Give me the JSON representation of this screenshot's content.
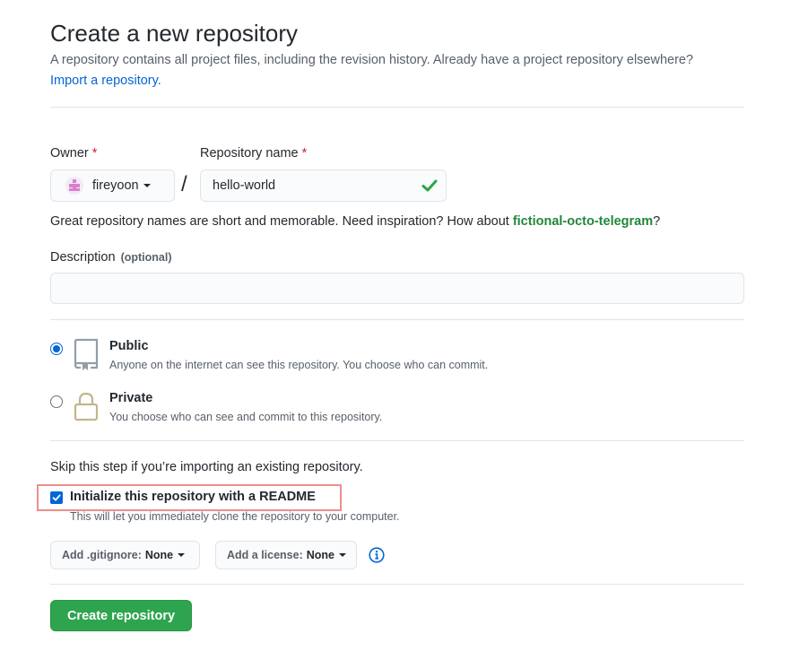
{
  "header": {
    "title": "Create a new repository",
    "subtitle": "A repository contains all project files, including the revision history. Already have a project repository elsewhere?",
    "import_link": "Import a repository."
  },
  "owner": {
    "label": "Owner",
    "required_mark": "*",
    "value": "fireyoon",
    "avatar_icon": "identicon-avatar"
  },
  "separator": "/",
  "repo_name": {
    "label": "Repository name",
    "required_mark": "*",
    "value": "hello-world",
    "status_icon": "check-icon"
  },
  "hint": {
    "text": "Great repository names are short and memorable. Need inspiration? How about ",
    "suggestion": "fictional-octo-telegram",
    "suffix": "?"
  },
  "description": {
    "label": "Description",
    "optional_label": "(optional)",
    "value": ""
  },
  "visibility": {
    "selected": "public",
    "options": [
      {
        "title": "Public",
        "description": "Anyone on the internet can see this repository. You choose who can commit.",
        "icon": "repo-icon"
      },
      {
        "title": "Private",
        "description": "You choose who can see and commit to this repository.",
        "icon": "lock-icon"
      }
    ]
  },
  "init": {
    "skip_text": "Skip this step if you’re importing an existing repository.",
    "readme_label": "Initialize this repository with a README",
    "readme_checked": true,
    "readme_note": "This will let you immediately clone the repository to your computer."
  },
  "gitignore": {
    "label": "Add .gitignore:",
    "value": "None"
  },
  "license": {
    "label": "Add a license:",
    "value": "None"
  },
  "submit": {
    "label": "Create repository"
  },
  "colors": {
    "link": "#0366d6",
    "primary_button": "#2ea44f",
    "suggestion": "#22863a",
    "required": "#cb2431",
    "highlight_box": "#ee8e8e"
  }
}
